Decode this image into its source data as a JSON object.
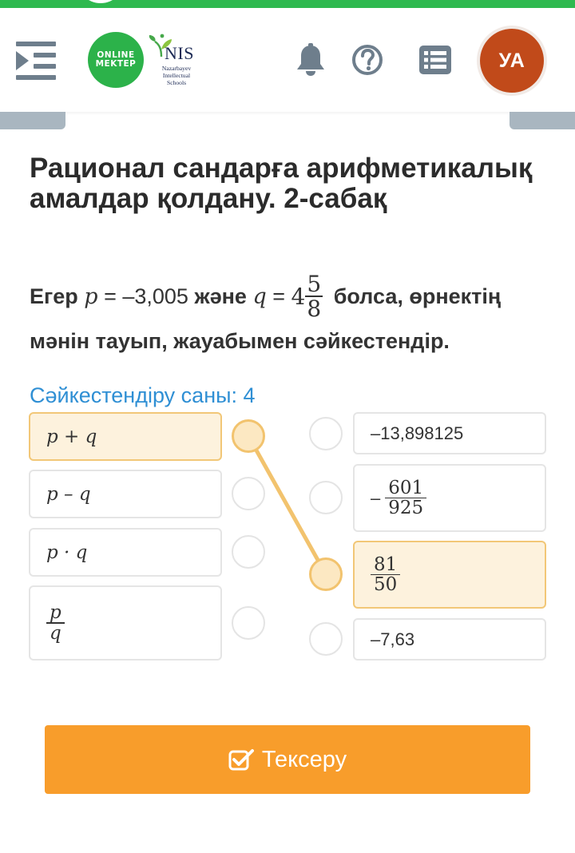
{
  "header": {
    "logo_line1": "ONLINE",
    "logo_line2": "MEKTEP",
    "nis_text": "NIS",
    "nis_sub": "Nazarbayev Intellectual Schools",
    "avatar_initials": "УА",
    "icons": [
      "menu-icon",
      "bell-icon",
      "help-icon",
      "list-icon"
    ]
  },
  "lesson": {
    "title": "Рационал сандарға арифметикалық амалдар қолдану. 2-сабақ"
  },
  "question": {
    "egerword": "Егер",
    "p_var": "p",
    "eq1": " = –3,005 ",
    "and_word": "және",
    "q_var": "q",
    "eq2": " = ",
    "q_whole": "4",
    "q_num": "5",
    "q_den": "8",
    "tail": "болса, өрнектің",
    "line2": "мәнін тауып, жауабымен сәйкестендір."
  },
  "match_count_label": "Сәйкестендіру саны: 4",
  "left_items": [
    {
      "label": "p + q",
      "selected": true
    },
    {
      "label": "p – q",
      "selected": false
    },
    {
      "label": "p · q",
      "selected": false
    },
    {
      "num": "p",
      "den": "q",
      "selected": false
    }
  ],
  "right_items": [
    {
      "label": "–13,898125",
      "selected": false
    },
    {
      "sign": "–",
      "num": "601",
      "den": "925",
      "selected": false
    },
    {
      "num": "81",
      "den": "50",
      "selected": true
    },
    {
      "label": "–7,63",
      "selected": false
    }
  ],
  "connections": [
    {
      "from_left": 0,
      "to_right": 2
    }
  ],
  "colors": {
    "accent_orange": "#f89d2b",
    "selection_yellow": "#f2c777",
    "count_blue": "#2f8fd4",
    "brand_green": "#2cb24a",
    "avatar": "#c14a1a"
  },
  "check_button": {
    "label": "Тексеру"
  }
}
